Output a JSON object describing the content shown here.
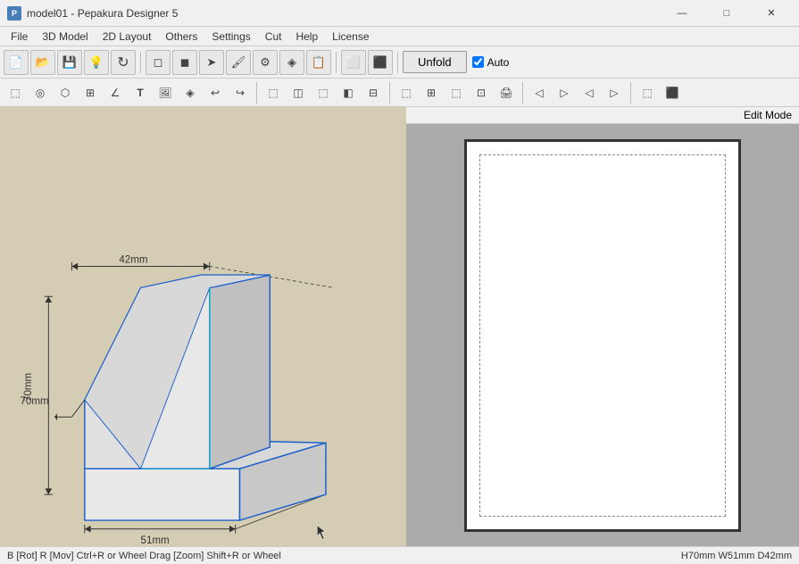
{
  "titlebar": {
    "app_icon": "P",
    "title": "model01 - Pepakura Designer 5",
    "minimize": "—",
    "maximize": "□",
    "close": "✕"
  },
  "menubar": {
    "items": [
      "File",
      "3D Model",
      "2D Layout",
      "Others",
      "Settings",
      "Cut",
      "Help",
      "License"
    ]
  },
  "toolbar1": {
    "unfold_label": "Unfold",
    "auto_label": "Auto",
    "buttons": [
      "📂",
      "💾",
      "💡",
      "🔄",
      "◻",
      "◻",
      "🔲",
      "🔲",
      "🔲",
      "🔲",
      "🔲",
      "🔲",
      "🔲",
      "🔲",
      "🔲",
      "🔲"
    ]
  },
  "toolbar2": {
    "buttons": [
      "◻",
      "◉",
      "⬡",
      "⧄",
      "◤",
      "T",
      "🖼",
      "⬡",
      "↩",
      "↪",
      "◻",
      "◻",
      "◻",
      "◻",
      "◻",
      "◻",
      "◻",
      "◻",
      "◻",
      "◻",
      "◻",
      "◻",
      "◻",
      "◻",
      "◻",
      "◻",
      "◻",
      "◻"
    ]
  },
  "edit_mode_label": "Edit Mode",
  "dimensions": {
    "width": "42mm",
    "height": "70mm",
    "depth": "51mm"
  },
  "statusbar": {
    "left_text": "B [Rot] R [Mov] Ctrl+R or Wheel Drag [Zoom] Shift+R or Wheel",
    "right_text": "H70mm W51mm D42mm"
  }
}
